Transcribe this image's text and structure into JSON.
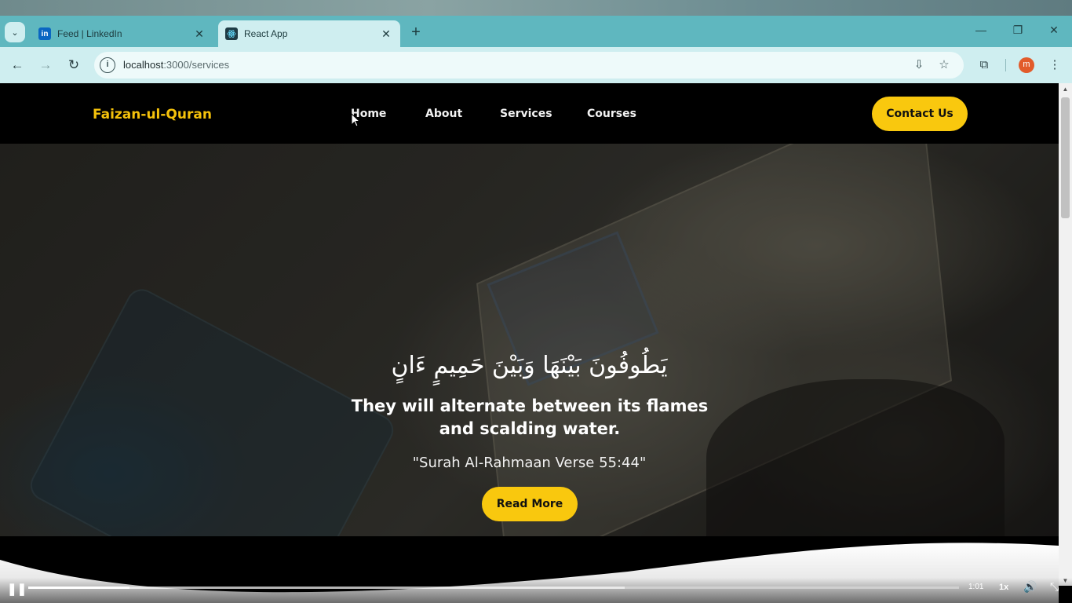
{
  "browser": {
    "tabs": [
      {
        "title": "Feed | LinkedIn",
        "favicon": "linkedin-icon",
        "favicon_color": "#0a66c2",
        "active": false
      },
      {
        "title": "React App",
        "favicon": "react-icon",
        "favicon_color": "#1f3b44",
        "active": true
      }
    ],
    "url_host": "localhost",
    "url_path": ":3000/services",
    "profile_initial": "m",
    "accent_color": "#5fb7bf"
  },
  "site": {
    "brand": "Faizan-ul-Quran",
    "nav": {
      "home": "Home",
      "about": "About",
      "services": "Services",
      "courses": "Courses"
    },
    "contact_label": "Contact Us",
    "accent_color": "#f9c80e",
    "hero": {
      "arabic_verse": "يَطُوفُونَ بَيْنَهَا وَبَيْنَ حَمِيمٍ ءَانٍ",
      "translation": "They will alternate between its flames and scalding water.",
      "reference": "\"Surah Al-Rahmaan Verse 55:44\"",
      "read_more_label": "Read More"
    }
  },
  "player": {
    "time": "1:01",
    "speed": "1x",
    "progress_played_fraction": 0.109,
    "progress_buffered_fraction": 0.641
  }
}
